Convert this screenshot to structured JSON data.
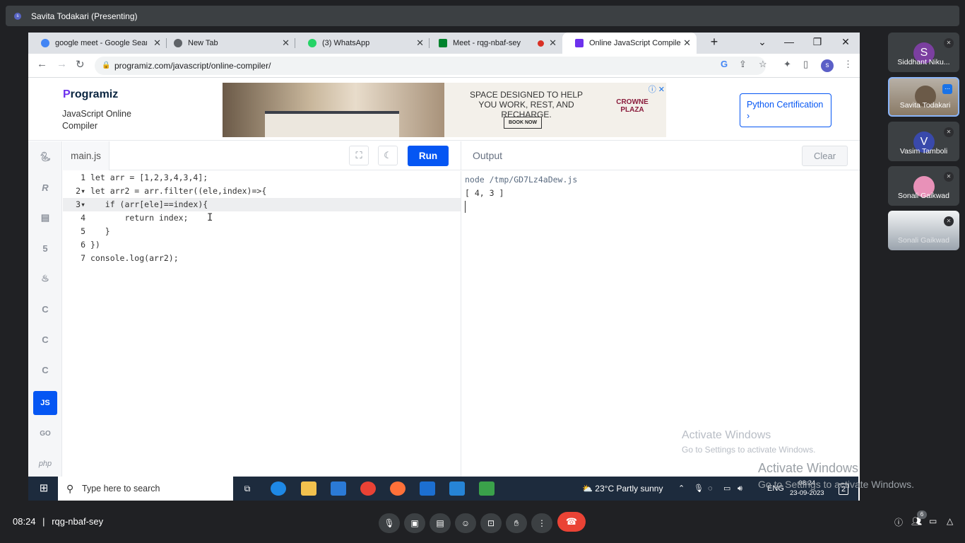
{
  "meet": {
    "presenting_label": "Savita Todakari (Presenting)",
    "time": "08:24",
    "separator": "|",
    "meeting_code": "rqg-nbaf-sey",
    "people_count": "6"
  },
  "browser": {
    "tabs": [
      {
        "title": "google meet - Google Search",
        "icon": "google-icon",
        "color": "#4285f4"
      },
      {
        "title": "New Tab",
        "icon": "chrome-icon",
        "color": "#5f6368"
      },
      {
        "title": "(3) WhatsApp",
        "icon": "whatsapp-icon",
        "color": "#25d366"
      },
      {
        "title": "Meet - rqg-nbaf-sey",
        "icon": "meet-icon",
        "color": "#00832d"
      },
      {
        "title": "Online JavaScript Compiler (Editor)",
        "icon": "programiz-icon",
        "color": "#6d31ed"
      }
    ],
    "url": "programiz.com/javascript/online-compiler/"
  },
  "header": {
    "logo": "rogramiz",
    "logo_prefix": "P",
    "subtitle": "JavaScript Online Compiler",
    "ad_text": "SPACE DESIGNED TO HELP YOU WORK, REST, AND RECHARGE.",
    "ad_button": "BOOK NOW",
    "ad_brand": "CROWNE PLAZA",
    "cert_button": "Python Certification ›"
  },
  "editor": {
    "file_tab": "main.js",
    "run_label": "Run",
    "lines": [
      {
        "n": "1",
        "code": "let arr = [1,2,3,4,3,4];"
      },
      {
        "n": "2▾",
        "code": "let arr2 = arr.filter((ele,index)=>{"
      },
      {
        "n": "3▾",
        "code": "   if (arr[ele]==index){"
      },
      {
        "n": "4",
        "code": "       return index;"
      },
      {
        "n": "5",
        "code": "   }"
      },
      {
        "n": "6",
        "code": "})"
      },
      {
        "n": "7",
        "code": "console.log(arr2);"
      }
    ]
  },
  "languages": [
    "python",
    "r",
    "sql",
    "html",
    "java",
    "c",
    "c++",
    "c#",
    "JS",
    "GO",
    "php"
  ],
  "output": {
    "label": "Output",
    "clear_label": "Clear",
    "command": "node /tmp/GD7Lz4aDew.js",
    "result": "[ 4, 3 ]"
  },
  "watermark": {
    "title": "Activate Windows",
    "subtitle": "Go to Settings to activate Windows."
  },
  "taskbar": {
    "search_placeholder": "Type here to search",
    "temperature": "23°C",
    "weather": "Partly sunny",
    "lang": "ENG",
    "time": "08:24",
    "date": "23-09-2023",
    "notif": "2"
  },
  "participants": [
    {
      "name": "Siddhant Niku...",
      "initial": "S",
      "color": "#7b3fa0"
    },
    {
      "name": "Savita Todakari",
      "initial": "",
      "color": "#8a7a66"
    },
    {
      "name": "Vasim Tamboli",
      "initial": "V",
      "color": "#3949ab"
    },
    {
      "name": "Sonali Gaikwad",
      "initial": "",
      "color": "#e891b8"
    },
    {
      "name": "Sonali Gaikwad",
      "initial": "",
      "color": "#c8ccd2"
    }
  ]
}
